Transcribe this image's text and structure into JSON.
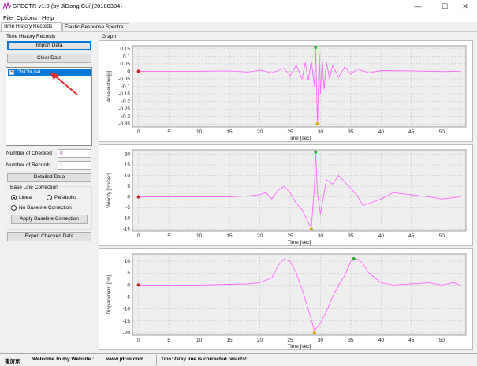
{
  "window": {
    "title": "SPECTR v1.0 (by JiDong Cui)(20180304)",
    "minimize_glyph": "—",
    "maximize_glyph": "☐",
    "close_glyph": "✕",
    "icon": "spectr-logo-icon"
  },
  "menu": {
    "items": [
      {
        "label": "File",
        "mnemonic": "F",
        "rest": "ile"
      },
      {
        "label": "Options",
        "mnemonic": "O",
        "rest": "ptions"
      },
      {
        "label": "Help",
        "mnemonic": "H",
        "rest": "elp"
      }
    ]
  },
  "tabs": [
    {
      "label": "Time History Records",
      "active": true
    },
    {
      "label": "Elastic Response Spectra",
      "active": false
    }
  ],
  "left_panel": {
    "group_title": "Time History Records",
    "import_label": "Import Data",
    "clear_label": "Clear Data",
    "records": [
      {
        "expander": "+",
        "name": "ChiChi.dat",
        "selected": true
      }
    ],
    "checked_label": "Number of Checked",
    "checked_value": "0",
    "records_label": "Number of Records",
    "records_value": "1",
    "detailed_label": "Detailed Data",
    "baseline": {
      "title": "Base Line Correction",
      "linear_label": "Linear",
      "parabolic_label": "Parabolic",
      "none_label": "No Baseline Correction",
      "selected": "Linear",
      "apply_label": "Apply Baseline Correction"
    },
    "export_label": "Export Checked Data"
  },
  "graph": {
    "title": "Graph"
  },
  "annotation": {
    "arrow_color": "#e03030"
  },
  "colors": {
    "signal": "#ff66ff",
    "marker_start": "#cc2222",
    "marker_max": "#33aa33",
    "marker_min": "#ddaa00",
    "selection": "#0078d7",
    "field_text": "#b04cb0"
  },
  "chart_data": [
    {
      "type": "line",
      "title": "",
      "xlabel": "Time [sec]",
      "ylabel": "Acceleration[g]",
      "xlim": [
        -1,
        54
      ],
      "ylim": [
        -0.37,
        0.17
      ],
      "x_ticks": [
        0,
        5,
        10,
        15,
        20,
        25,
        30,
        35,
        40,
        45,
        50
      ],
      "y_ticks": [
        0.15,
        0.1,
        0.05,
        0,
        -0.05,
        -0.1,
        -0.15,
        -0.2,
        -0.25,
        -0.3,
        -0.35
      ],
      "y_tick_labels": [
        "0.15",
        "0.1",
        "0.05",
        "0",
        "-0.05",
        "-0.1",
        "-0.15",
        "-0.2",
        "-0.25",
        "-0.3",
        "-0.35"
      ],
      "grid": true,
      "series": [
        {
          "x": [
            0,
            5,
            10,
            15,
            18,
            20,
            22,
            24,
            25,
            26,
            27,
            27.5,
            28,
            28.5,
            29,
            29.2,
            29.5,
            29.8,
            30,
            30.3,
            30.6,
            31,
            31.5,
            32,
            33,
            34,
            35,
            36,
            38,
            40,
            45,
            50,
            53
          ],
          "y": [
            0,
            0,
            0,
            0.003,
            -0.005,
            0.008,
            -0.01,
            0.02,
            -0.03,
            0.04,
            -0.05,
            0.06,
            -0.06,
            0.07,
            -0.1,
            0.16,
            -0.35,
            0.12,
            -0.15,
            0.08,
            -0.12,
            0.06,
            -0.05,
            0.04,
            -0.04,
            0.03,
            -0.02,
            0.015,
            -0.01,
            0.005,
            0.003,
            -0.002,
            0
          ]
        }
      ],
      "markers": {
        "start": [
          0,
          0
        ],
        "max": [
          29.2,
          0.16
        ],
        "min": [
          29.5,
          -0.35
        ]
      }
    },
    {
      "type": "line",
      "title": "",
      "xlabel": "Time [sec]",
      "ylabel": "Velocity [cm/sec]",
      "xlim": [
        -1,
        54
      ],
      "ylim": [
        -16,
        22
      ],
      "x_ticks": [
        0,
        5,
        10,
        15,
        20,
        25,
        30,
        35,
        40,
        45,
        50
      ],
      "y_ticks": [
        20,
        15,
        10,
        5,
        0,
        -5,
        -10,
        -15
      ],
      "y_tick_labels": [
        "20",
        "15",
        "10",
        "5",
        "0",
        "-5",
        "-10",
        "-15"
      ],
      "grid": true,
      "series": [
        {
          "x": [
            0,
            5,
            10,
            15,
            18,
            20,
            21,
            22,
            23,
            24,
            25,
            26,
            27,
            28,
            28.5,
            29,
            29.2,
            29.5,
            30,
            31,
            32,
            33,
            34,
            35,
            36,
            37,
            38,
            40,
            42,
            45,
            48,
            50,
            53
          ],
          "y": [
            0,
            0,
            0,
            0,
            0.5,
            1,
            2,
            -1,
            3,
            5,
            2,
            -3,
            -6,
            -12,
            -14,
            4,
            21,
            2,
            -8,
            8,
            6,
            10,
            7,
            4,
            1,
            -4,
            -3,
            -1,
            2,
            1,
            0,
            -1,
            0
          ]
        }
      ],
      "markers": {
        "start": [
          0,
          0
        ],
        "max": [
          29.2,
          21
        ],
        "min": [
          28.5,
          -15
        ]
      }
    },
    {
      "type": "line",
      "title": "",
      "xlabel": "Time [sec]",
      "ylabel": "Displacement [cm]",
      "xlim": [
        -1,
        54
      ],
      "ylim": [
        -21,
        13
      ],
      "x_ticks": [
        0,
        5,
        10,
        15,
        20,
        25,
        30,
        35,
        40,
        45,
        50
      ],
      "y_ticks": [
        10,
        5,
        0,
        -5,
        -10,
        -15,
        -20
      ],
      "y_tick_labels": [
        "10",
        "5",
        "0",
        "-5",
        "-10",
        "-15",
        "-20"
      ],
      "grid": true,
      "series": [
        {
          "x": [
            0,
            5,
            10,
            15,
            18,
            20,
            22,
            23,
            24,
            25,
            26,
            27,
            28,
            29,
            30,
            31,
            32,
            33,
            34,
            35,
            36,
            37,
            38,
            40,
            42,
            45,
            48,
            50,
            52,
            53
          ],
          "y": [
            0,
            0,
            0,
            0.3,
            0.5,
            1,
            3,
            8,
            11,
            10,
            5,
            -2,
            -10,
            -19,
            -16,
            -11,
            -5,
            0,
            4,
            10,
            11,
            9,
            5,
            1,
            0,
            0.5,
            1,
            0,
            1,
            0
          ]
        }
      ],
      "markers": {
        "start": [
          0,
          0
        ],
        "max": [
          35.5,
          11
        ],
        "min": [
          29,
          -20
        ]
      }
    }
  ],
  "status": {
    "author": "崔济东",
    "welcome": "Welcome to my Website :",
    "website": "www.jdcui.com",
    "tip": "Tips: Grey line is corrected results!"
  }
}
